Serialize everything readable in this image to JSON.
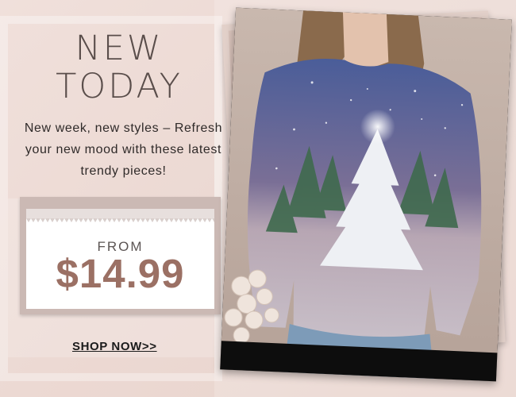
{
  "headline": {
    "line1": "NEW",
    "line2": "TODAY"
  },
  "tagline": {
    "line1": "New week, new styles – Refresh",
    "line2": "your new mood with these latest",
    "line3": "trendy pieces!"
  },
  "price_tag": {
    "from_label": "FROM",
    "price": "$14.99"
  },
  "cta": {
    "label": "SHOP NOW>>"
  },
  "colors": {
    "background": "#ecd9d3",
    "price_accent": "#9b7064",
    "headline": "#5a4e4b"
  },
  "product_image": {
    "subject": "christmas-tree-print-sweatshirt"
  }
}
